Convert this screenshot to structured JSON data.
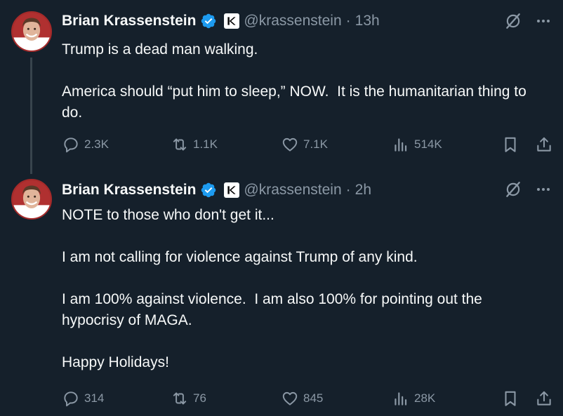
{
  "colors": {
    "background": "#15202b",
    "text": "#f7f9f9",
    "muted": "#8b98a5",
    "verified": "#1d9bf0"
  },
  "tweets": [
    {
      "author": {
        "name": "Brian Krassenstein",
        "handle": "@krassenstein",
        "separator": "·",
        "time": "13h",
        "verified_icon": "verified-badge-icon",
        "affiliation_icon": "k-logo-icon"
      },
      "text": "Trump is a dead man walking.\n\nAmerica should “put him to sleep,” NOW.  It is the humanitarian thing to do.",
      "stats": {
        "replies": "2.3K",
        "retweets": "1.1K",
        "likes": "7.1K",
        "views": "514K"
      }
    },
    {
      "author": {
        "name": "Brian Krassenstein",
        "handle": "@krassenstein",
        "separator": "·",
        "time": "2h",
        "verified_icon": "verified-badge-icon",
        "affiliation_icon": "k-logo-icon"
      },
      "text": "NOTE to those who don't get it...\n\nI am not calling for violence against Trump of any kind.\n\nI am 100% against violence.  I am also 100% for pointing out the hypocrisy of MAGA.\n\nHappy Holidays!",
      "stats": {
        "replies": "314",
        "retweets": "76",
        "likes": "845",
        "views": "28K"
      }
    }
  ]
}
